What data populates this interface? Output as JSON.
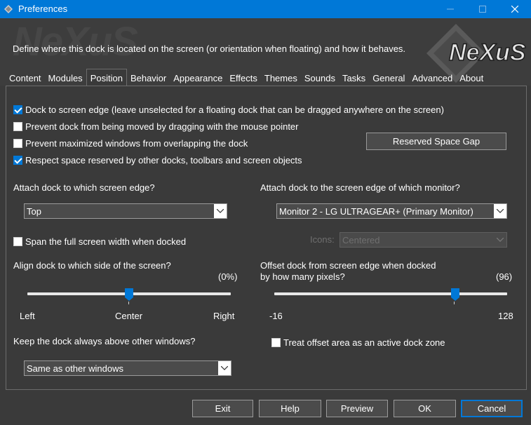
{
  "window": {
    "title": "Preferences",
    "close_color": "#ffffff",
    "accent": "#0078d7"
  },
  "banner": {
    "watermark": "NeXuS",
    "description": "Define where this dock is located on the screen (or orientation when floating) and how it behaves.",
    "logo_text": "NeXuS"
  },
  "tabs": [
    {
      "label": "Content"
    },
    {
      "label": "Modules"
    },
    {
      "label": "Position",
      "active": true
    },
    {
      "label": "Behavior"
    },
    {
      "label": "Appearance"
    },
    {
      "label": "Effects"
    },
    {
      "label": "Themes"
    },
    {
      "label": "Sounds"
    },
    {
      "label": "Tasks"
    },
    {
      "label": "General"
    },
    {
      "label": "Advanced"
    },
    {
      "label": "About"
    }
  ],
  "options": {
    "dock_to_edge": {
      "label": "Dock to screen edge (leave unselected for a floating dock that can be dragged anywhere on the screen)",
      "checked": true
    },
    "prevent_drag": {
      "label": "Prevent dock from being moved by dragging with the mouse pointer",
      "checked": false
    },
    "prevent_overlap": {
      "label": "Prevent maximized windows from overlapping the dock",
      "checked": false
    },
    "respect_space": {
      "label": "Respect space reserved by other docks, toolbars and screen objects",
      "checked": true
    },
    "reserved_gap_button": "Reserved Space Gap"
  },
  "edge": {
    "label": "Attach dock to which screen edge?",
    "value": "Top"
  },
  "monitor": {
    "label": "Attach dock to the screen edge of which monitor?",
    "value": "Monitor 2 - LG ULTRAGEAR+ (Primary Monitor)"
  },
  "span": {
    "label": "Span the full screen width when docked",
    "checked": false
  },
  "icons": {
    "label": "Icons:",
    "value": "Centered"
  },
  "align": {
    "label": "Align dock to which side of the screen?",
    "value_text": "(0%)",
    "value": 0,
    "min": -100,
    "max": 100,
    "left_label": "Left",
    "center_label": "Center",
    "right_label": "Right"
  },
  "offset": {
    "label_line1": "Offset dock from screen edge when docked",
    "label_line2": "by how many pixels?",
    "value_text": "(96)",
    "value": 96,
    "min": -16,
    "max": 128,
    "min_label": "-16",
    "max_label": "128"
  },
  "above": {
    "label": "Keep the dock always above other windows?",
    "value": "Same as other windows"
  },
  "offset_zone": {
    "label": "Treat offset area as an active dock zone",
    "checked": false
  },
  "buttons": {
    "exit": "Exit",
    "help": "Help",
    "preview": "Preview",
    "ok": "OK",
    "cancel": "Cancel"
  }
}
